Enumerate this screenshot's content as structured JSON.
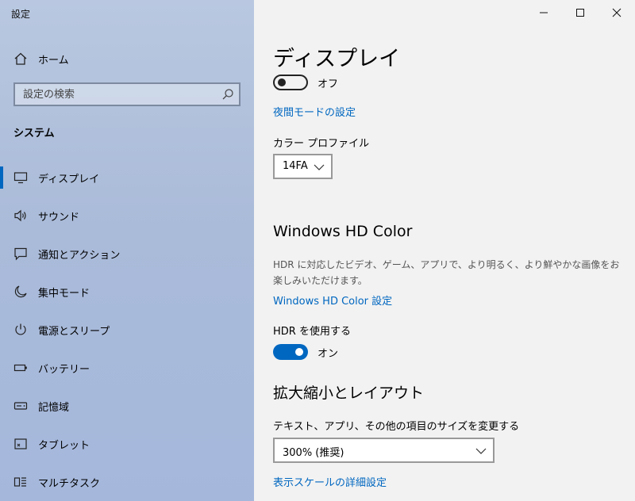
{
  "app": {
    "title": "設定"
  },
  "sidebar": {
    "home_label": "ホーム",
    "search_placeholder": "設定の検索",
    "section": "システム",
    "items": [
      {
        "label": "ディスプレイ",
        "icon": "monitor-icon",
        "active": true
      },
      {
        "label": "サウンド",
        "icon": "speaker-icon"
      },
      {
        "label": "通知とアクション",
        "icon": "notification-icon"
      },
      {
        "label": "集中モード",
        "icon": "moon-icon"
      },
      {
        "label": "電源とスリープ",
        "icon": "power-icon"
      },
      {
        "label": "バッテリー",
        "icon": "battery-icon"
      },
      {
        "label": "記憶域",
        "icon": "storage-icon"
      },
      {
        "label": "タブレット",
        "icon": "tablet-icon"
      },
      {
        "label": "マルチタスク",
        "icon": "multitask-icon"
      }
    ]
  },
  "main": {
    "title": "ディスプレイ",
    "night_light": {
      "state": "オフ",
      "on": false
    },
    "night_light_link": "夜間モードの設定",
    "color_profile": {
      "label": "カラー プロファイル",
      "value": "14FA"
    },
    "hdr_section": {
      "title": "Windows HD Color",
      "description": "HDR に対応したビデオ、ゲーム、アプリで、より明るく、より鮮やかな画像をお楽しみいただけます。",
      "link": "Windows HD Color 設定",
      "use_hdr_label": "HDR を使用する",
      "use_hdr_state": "オン",
      "use_hdr_on": true
    },
    "scale_section": {
      "title": "拡大縮小とレイアウト",
      "scale_label": "テキスト、アプリ、その他の項目のサイズを変更する",
      "scale_value": "300% (推奨)",
      "advanced_link": "表示スケールの詳細設定"
    }
  },
  "colors": {
    "accent": "#0067c0"
  }
}
